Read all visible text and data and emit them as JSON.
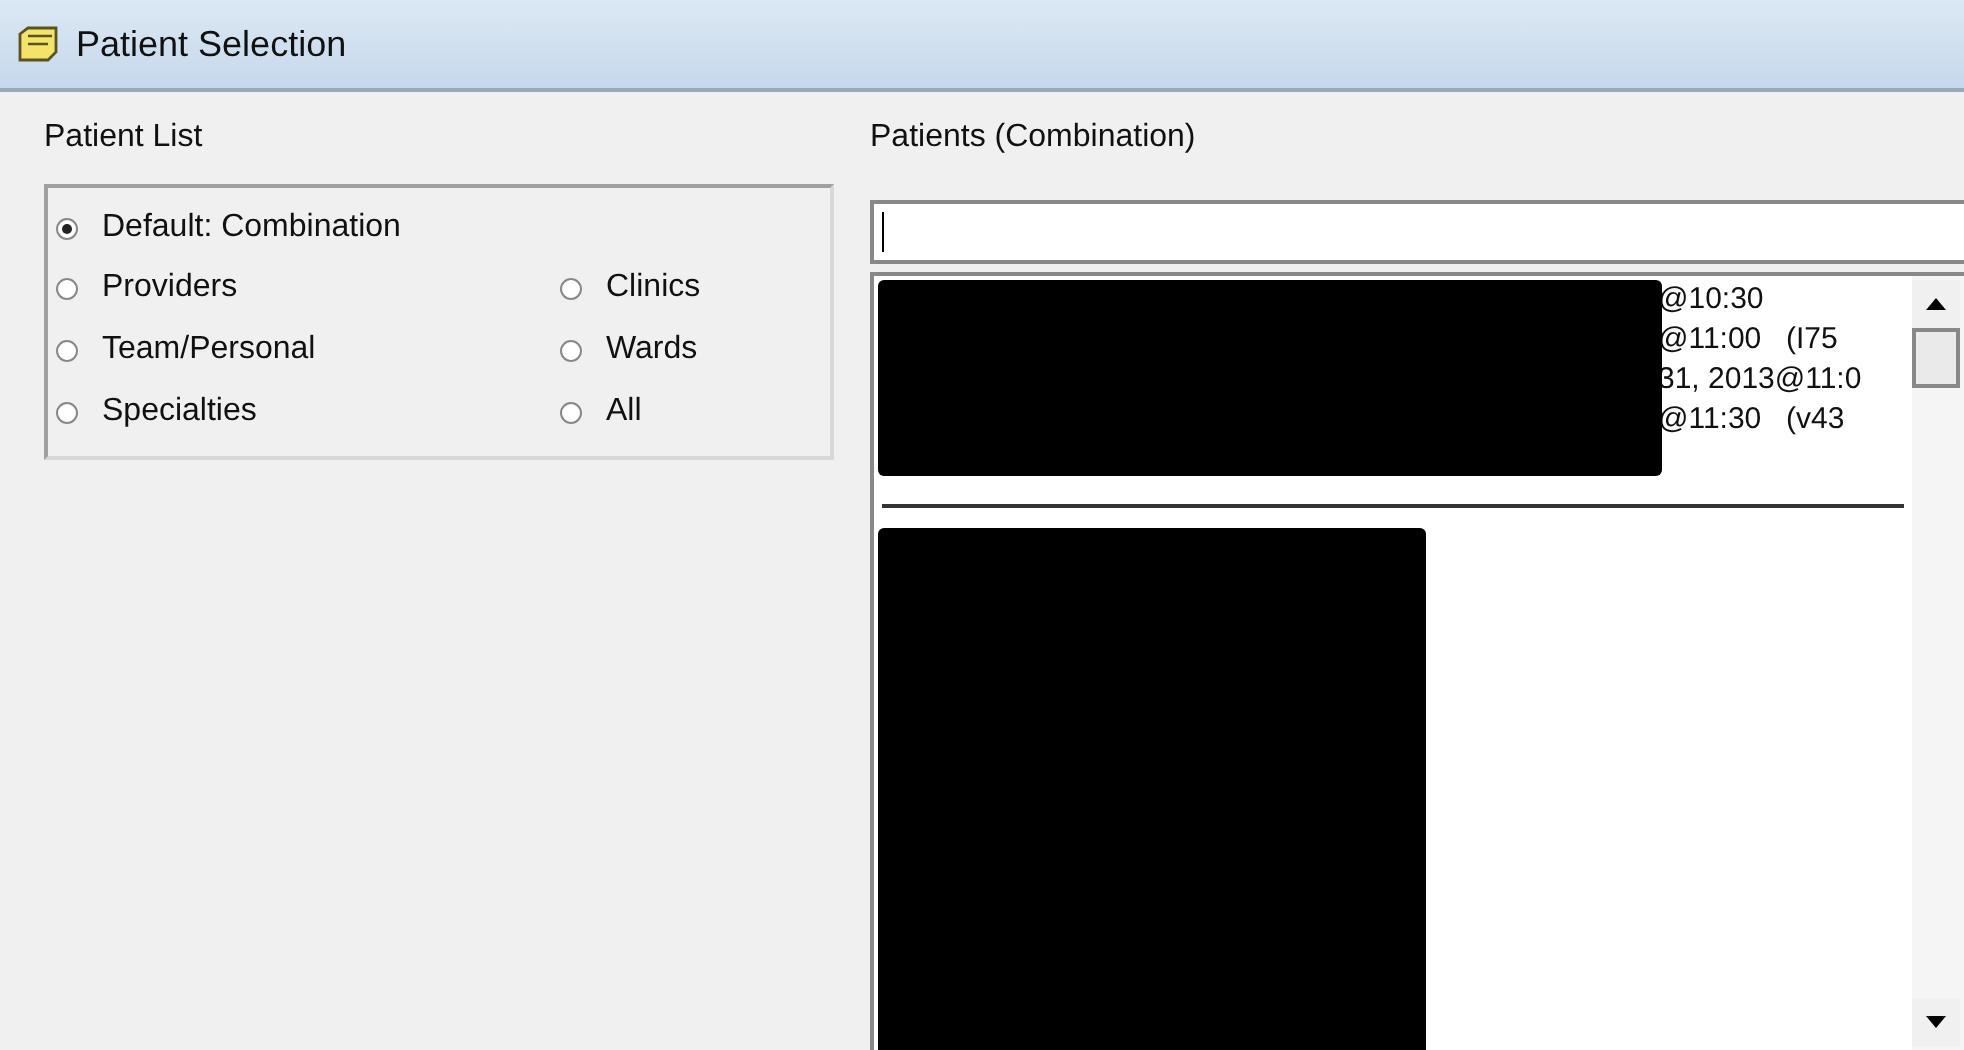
{
  "window": {
    "title": "Patient Selection"
  },
  "patient_list": {
    "label": "Patient List",
    "options": [
      {
        "label": "Default: Combination",
        "selected": true
      },
      {
        "label": "Providers",
        "selected": false
      },
      {
        "label": "Team/Personal",
        "selected": false
      },
      {
        "label": "Specialties",
        "selected": false
      },
      {
        "label": "Clinics",
        "selected": false
      },
      {
        "label": "Wards",
        "selected": false
      },
      {
        "label": "All",
        "selected": false
      }
    ]
  },
  "patients": {
    "label": "Patients (Combination)",
    "rows": [
      {
        "time": "@10:30"
      },
      {
        "time": "@11:00",
        "detail": "(I75"
      },
      {
        "time": "31, 2013@11:0"
      },
      {
        "time": "@11:30",
        "detail": "(v43"
      }
    ]
  }
}
